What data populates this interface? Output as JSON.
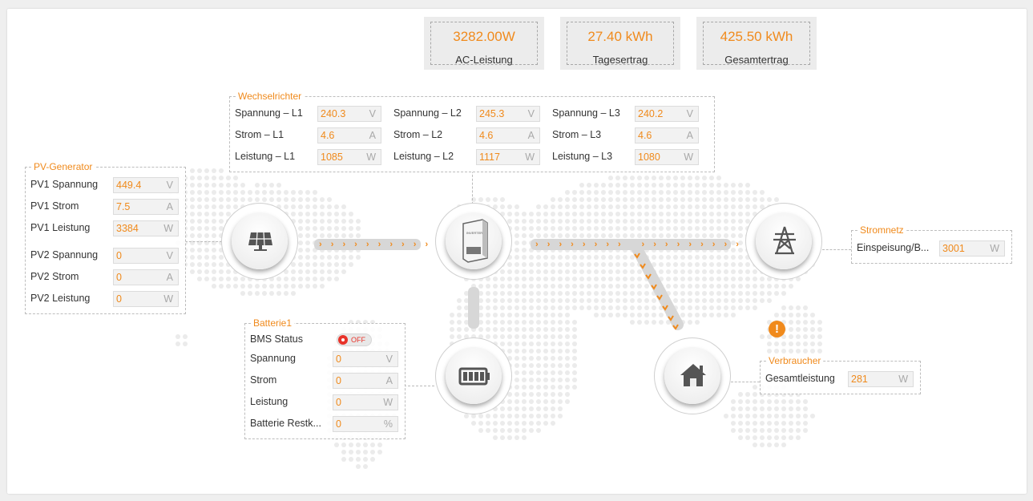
{
  "colors": {
    "accent": "#f08a1c",
    "pipe": "#d7d7d7",
    "off": "#e8332a"
  },
  "kpis": [
    {
      "value": "3282.00W",
      "label": "AC-Leistung"
    },
    {
      "value": "27.40 kWh",
      "label": "Tagesertrag"
    },
    {
      "value": "425.50 kWh",
      "label": "Gesamtertrag"
    }
  ],
  "inverter": {
    "title": "Wechselrichter",
    "phases": [
      {
        "spannung_label": "Spannung – L1",
        "spannung": "240.3",
        "strom_label": "Strom – L1",
        "strom": "4.6",
        "leistung_label": "Leistung – L1",
        "leistung": "1085"
      },
      {
        "spannung_label": "Spannung – L2",
        "spannung": "245.3",
        "strom_label": "Strom – L2",
        "strom": "4.6",
        "leistung_label": "Leistung – L2",
        "leistung": "1117"
      },
      {
        "spannung_label": "Spannung – L3",
        "spannung": "240.2",
        "strom_label": "Strom – L3",
        "strom": "4.6",
        "leistung_label": "Leistung – L3",
        "leistung": "1080"
      }
    ],
    "units": {
      "v": "V",
      "a": "A",
      "w": "W"
    },
    "brand": "INVERTER"
  },
  "pv": {
    "title": "PV-Generator",
    "rows": [
      {
        "label": "PV1 Spannung",
        "value": "449.4",
        "unit": "V"
      },
      {
        "label": "PV1 Strom",
        "value": "7.5",
        "unit": "A"
      },
      {
        "label": "PV1 Leistung",
        "value": "3384",
        "unit": "W"
      },
      {
        "label": "PV2 Spannung",
        "value": "0",
        "unit": "V"
      },
      {
        "label": "PV2 Strom",
        "value": "0",
        "unit": "A"
      },
      {
        "label": "PV2 Leistung",
        "value": "0",
        "unit": "W"
      }
    ]
  },
  "grid": {
    "title": "Stromnetz",
    "label": "Einspeisung/B...",
    "value": "3001",
    "unit": "W"
  },
  "battery": {
    "title": "Batterie1",
    "bms_label": "BMS Status",
    "bms_state": "OFF",
    "rows": [
      {
        "label": "Spannung",
        "value": "0",
        "unit": "V"
      },
      {
        "label": "Strom",
        "value": "0",
        "unit": "A"
      },
      {
        "label": "Leistung",
        "value": "0",
        "unit": "W"
      },
      {
        "label": "Batterie Restk...",
        "value": "0",
        "unit": "%"
      }
    ]
  },
  "consumer": {
    "title": "Verbraucher",
    "label": "Gesamtleistung",
    "value": "281",
    "unit": "W"
  },
  "warning": {
    "glyph": "!",
    "icon": "warning-icon"
  }
}
